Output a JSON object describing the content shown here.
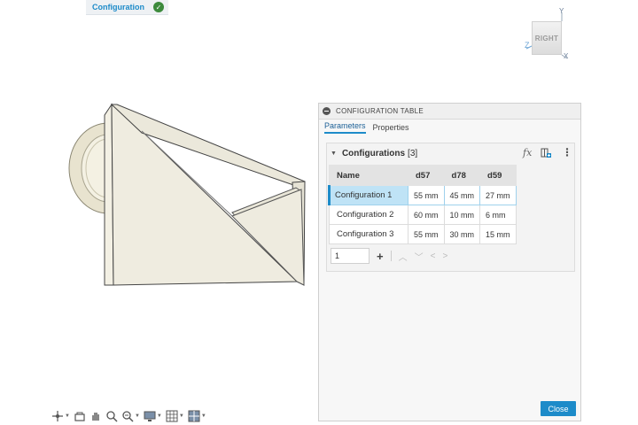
{
  "configuration_pill": {
    "label": "Configuration"
  },
  "view_cube": {
    "face": "RIGHT",
    "axes": {
      "y": "Y",
      "z": "Z",
      "x": "X"
    }
  },
  "panel": {
    "title": "CONFIGURATION TABLE",
    "tabs": [
      {
        "label": "Parameters",
        "active": true
      },
      {
        "label": "Properties",
        "active": false
      }
    ],
    "configurations": {
      "title": "Configurations",
      "count": "[3]",
      "icons": [
        "fx-icon",
        "insert-column-icon",
        "more-options-icon"
      ],
      "columns": [
        "Name",
        "d57",
        "d78",
        "d59"
      ],
      "rows": [
        {
          "name": "Configuration 1",
          "d57": "55 mm",
          "d78": "45 mm",
          "d59": "27 mm",
          "selected": true
        },
        {
          "name": "Configuration 2",
          "d57": "60 mm",
          "d78": "10 mm",
          "d59": "6 mm",
          "selected": false
        },
        {
          "name": "Configuration 3",
          "d57": "55 mm",
          "d78": "30 mm",
          "d59": "15 mm",
          "selected": false
        }
      ],
      "row_count_input": "1",
      "add_label": "+"
    },
    "close_label": "Close"
  },
  "toolbar": {
    "icons": [
      "orbit-icon",
      "look-at-icon",
      "pan-icon",
      "zoom-icon",
      "fit-icon",
      "display-settings-icon",
      "grid-icon",
      "viewports-icon"
    ]
  },
  "colors": {
    "accent": "#1d8bc9",
    "selected_row": "#bfe3f6",
    "model_face": "#efece0",
    "success": "#3c8a3c"
  }
}
